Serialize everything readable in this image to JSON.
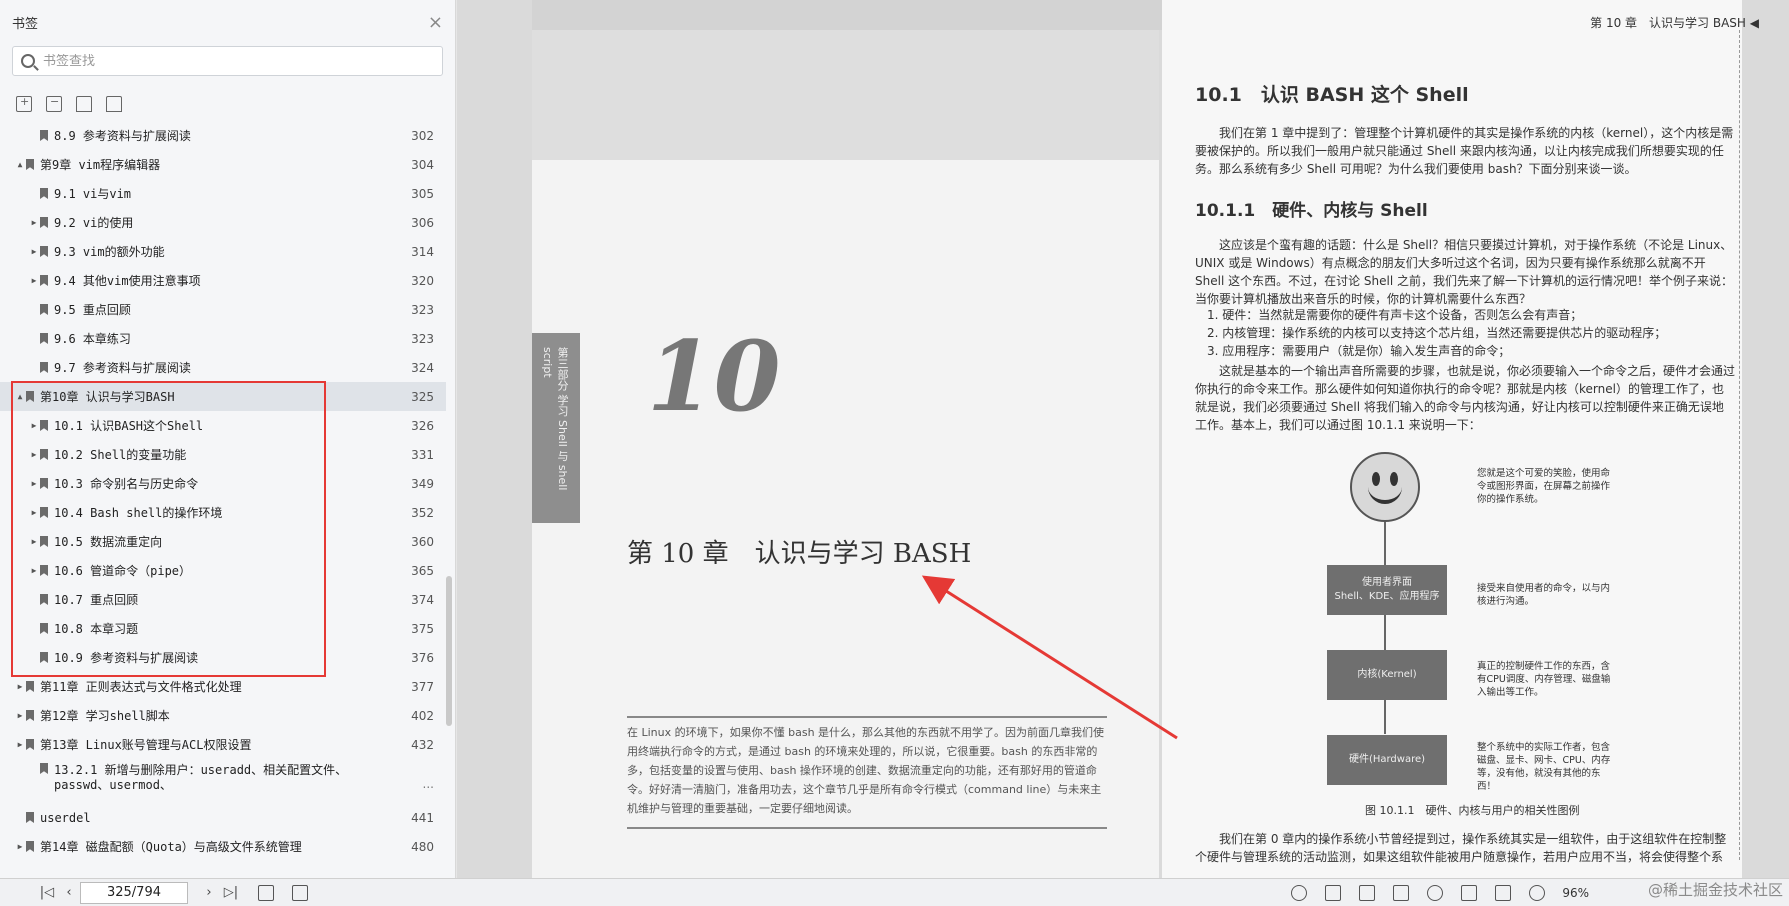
{
  "sidebar": {
    "title": "书签",
    "search_placeholder": "书签查找",
    "toc": [
      {
        "label": "8.9 参考资料与扩展阅读",
        "page": "302",
        "level": 2,
        "arrow": ""
      },
      {
        "label": "第9章 vim程序编辑器",
        "page": "304",
        "level": 1,
        "arrow": "▲"
      },
      {
        "label": "9.1 vi与vim",
        "page": "305",
        "level": 2,
        "arrow": ""
      },
      {
        "label": "9.2 vi的使用",
        "page": "306",
        "level": 2,
        "arrow": "▶"
      },
      {
        "label": "9.3 vim的额外功能",
        "page": "314",
        "level": 2,
        "arrow": "▶"
      },
      {
        "label": "9.4 其他vim使用注意事项",
        "page": "320",
        "level": 2,
        "arrow": "▶"
      },
      {
        "label": "9.5 重点回顾",
        "page": "323",
        "level": 2,
        "arrow": ""
      },
      {
        "label": "9.6 本章练习",
        "page": "323",
        "level": 2,
        "arrow": ""
      },
      {
        "label": "9.7 参考资料与扩展阅读",
        "page": "324",
        "level": 2,
        "arrow": ""
      },
      {
        "label": "第10章 认识与学习BASH",
        "page": "325",
        "level": 1,
        "arrow": "▲",
        "selected": true
      },
      {
        "label": "10.1 认识BASH这个Shell",
        "page": "326",
        "level": 2,
        "arrow": "▶"
      },
      {
        "label": "10.2 Shell的变量功能",
        "page": "331",
        "level": 2,
        "arrow": "▶"
      },
      {
        "label": "10.3 命令别名与历史命令",
        "page": "349",
        "level": 2,
        "arrow": "▶"
      },
      {
        "label": "10.4 Bash shell的操作环境",
        "page": "352",
        "level": 2,
        "arrow": "▶"
      },
      {
        "label": "10.5 数据流重定向",
        "page": "360",
        "level": 2,
        "arrow": "▶"
      },
      {
        "label": "10.6 管道命令（pipe）",
        "page": "365",
        "level": 2,
        "arrow": "▶"
      },
      {
        "label": "10.7 重点回顾",
        "page": "374",
        "level": 2,
        "arrow": ""
      },
      {
        "label": "10.8 本章习题",
        "page": "375",
        "level": 2,
        "arrow": ""
      },
      {
        "label": "10.9 参考资料与扩展阅读",
        "page": "376",
        "level": 2,
        "arrow": ""
      },
      {
        "label": "第11章 正则表达式与文件格式化处理",
        "page": "377",
        "level": 1,
        "arrow": "▶"
      },
      {
        "label": "第12章 学习shell脚本",
        "page": "402",
        "level": 1,
        "arrow": "▶"
      },
      {
        "label": "第13章 Linux账号管理与ACL权限设置",
        "page": "432",
        "level": 1,
        "arrow": "▶"
      },
      {
        "label": "13.2.1 新增与删除用户：useradd、相关配置文件、passwd、usermod、",
        "page": "...",
        "level": 2,
        "arrow": "",
        "multi": true
      },
      {
        "label": "userdel",
        "page": "441",
        "level": 1,
        "arrow": ""
      },
      {
        "label": "第14章 磁盘配额（Quota）与高级文件系统管理",
        "page": "480",
        "level": 1,
        "arrow": "▶"
      }
    ]
  },
  "doc": {
    "left_page": {
      "section_tab": "第三部分 学习 Shell 与 shell script",
      "chapter_number": "10",
      "chapter_title": "第 10 章　认识与学习 BASH",
      "intro": "在 Linux 的环境下，如果你不懂 bash 是什么，那么其他的东西就不用学了。因为前面几章我们使用终端执行命令的方式，是通过 bash 的环境来处理的，所以说，它很重要。bash 的东西非常的多，包括变量的设置与使用、bash 操作环境的创建、数据流重定向的功能，还有那好用的管道命令。好好清一清脑门，准备用功去，这个章节几乎是所有命令行模式（command line）与未来主机维护与管理的重要基础，一定要仔细地阅读。"
    },
    "right_page": {
      "header": "第 10 章　认识与学习 BASH ◀",
      "section_title": "10.1　认识 BASH 这个 Shell",
      "para1": "我们在第 1 章中提到了：管理整个计算机硬件的其实是操作系统的内核（kernel），这个内核是需要被保护的。所以我们一般用户就只能通过 Shell 来跟内核沟通，以让内核完成我们所想要实现的任务。那么系统有多少 Shell 可用呢？为什么我们要使用 bash？下面分别来谈一谈。",
      "subsection_title": "10.1.1　硬件、内核与 Shell",
      "para2": "这应该是个蛮有趣的话题：什么是 Shell？相信只要摸过计算机，对于操作系统（不论是 Linux、UNIX 或是 Windows）有点概念的朋友们大多听过这个名词，因为只要有操作系统那么就离不开 Shell 这个东西。不过，在讨论 Shell 之前，我们先来了解一下计算机的运行情况吧！举个例子来说：当你要计算机播放出来音乐的时候，你的计算机需要什么东西？",
      "list": [
        "1.  硬件：当然就是需要你的硬件有声卡这个设备，否则怎么会有声音；",
        "2.  内核管理：操作系统的内核可以支持这个芯片组，当然还需要提供芯片的驱动程序；",
        "3.  应用程序：需要用户（就是你）输入发生声音的命令；"
      ],
      "para3": "这就是基本的一个输出声音所需要的步骤，也就是说，你必须要输入一个命令之后，硬件才会通过你执行的命令来工作。那么硬件如何知道你执行的命令呢？那就是内核（kernel）的管理工作了，也就是说，我们必须要通过 Shell 将我们输入的命令与内核沟通，好让内核可以控制硬件来正确无误地工作。基本上，我们可以通过图 10.1.1 来说明一下：",
      "diagram": {
        "box1": [
          "使用者界面",
          "Shell、KDE、应用程序"
        ],
        "box2": "内核(Kernel)",
        "box3": "硬件(Hardware)",
        "note1": "您就是这个可爱的笑脸，使用命令或图形界面，在屏幕之前操作你的操作系统。",
        "note2": "接受来自使用者的命令，以与内核进行沟通。",
        "note3": "真正的控制硬件工作的东西，含有CPU调度、内存管理、磁盘输入输出等工作。",
        "note4": "整个系统中的实际工作者，包含磁盘、显卡、网卡、CPU、内存等，没有他，就没有其他的东西！",
        "caption": "图 10.1.1　硬件、内核与用户的相关性图例"
      },
      "para4": "我们在第 0 章内的操作系统小节曾经提到过，操作系统其实是一组软件，由于这组软件在控制整个硬件与管理系统的活动监测，如果这组软件能被用户随意操作，若用户应用不当，将会使得整个系"
    }
  },
  "statusbar": {
    "page_indicator": "325/794",
    "zoom": "96%",
    "watermark": "@稀土掘金技术社区"
  }
}
